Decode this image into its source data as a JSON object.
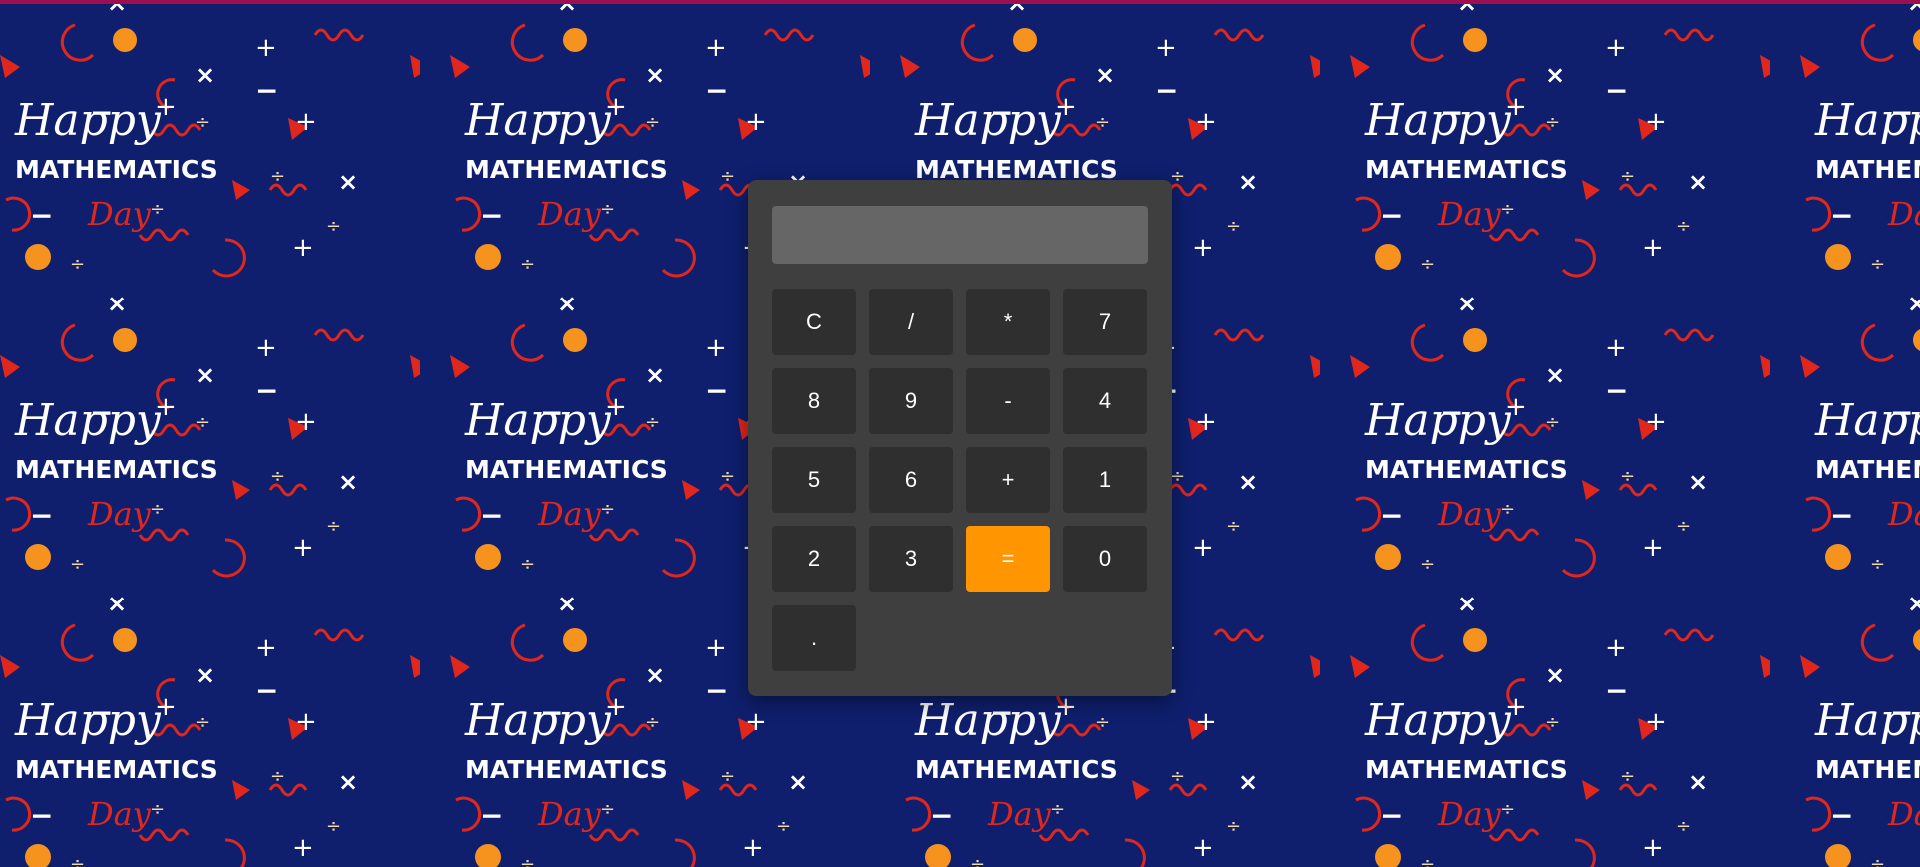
{
  "wallpaper": {
    "background_color": "#0f1f6e",
    "accent_strip_color": "#9c1050",
    "tile": {
      "line1": "Happy",
      "line2": "MATHEMATICS",
      "line3": "Day"
    },
    "symbols": [
      "+",
      "−",
      "×",
      "÷"
    ],
    "decoration_colors": {
      "dots": "#f6921e",
      "triangles": "#e1261c",
      "squiggles": "#e1261c",
      "symbols": "#ffffff"
    }
  },
  "calculator": {
    "display": {
      "value": "",
      "placeholder": ""
    },
    "colors": {
      "body": "#3f3f3f",
      "display": "#666666",
      "key": "#2f2f2f",
      "equals_key": "#ff9500",
      "key_text": "#ffffff"
    },
    "keys": {
      "clear": "C",
      "divide": "/",
      "multiply": "*",
      "seven": "7",
      "eight": "8",
      "nine": "9",
      "subtract": "-",
      "four": "4",
      "five": "5",
      "six": "6",
      "add": "+",
      "one": "1",
      "two": "2",
      "three": "3",
      "equals": "=",
      "zero": "0",
      "decimal": "."
    }
  }
}
